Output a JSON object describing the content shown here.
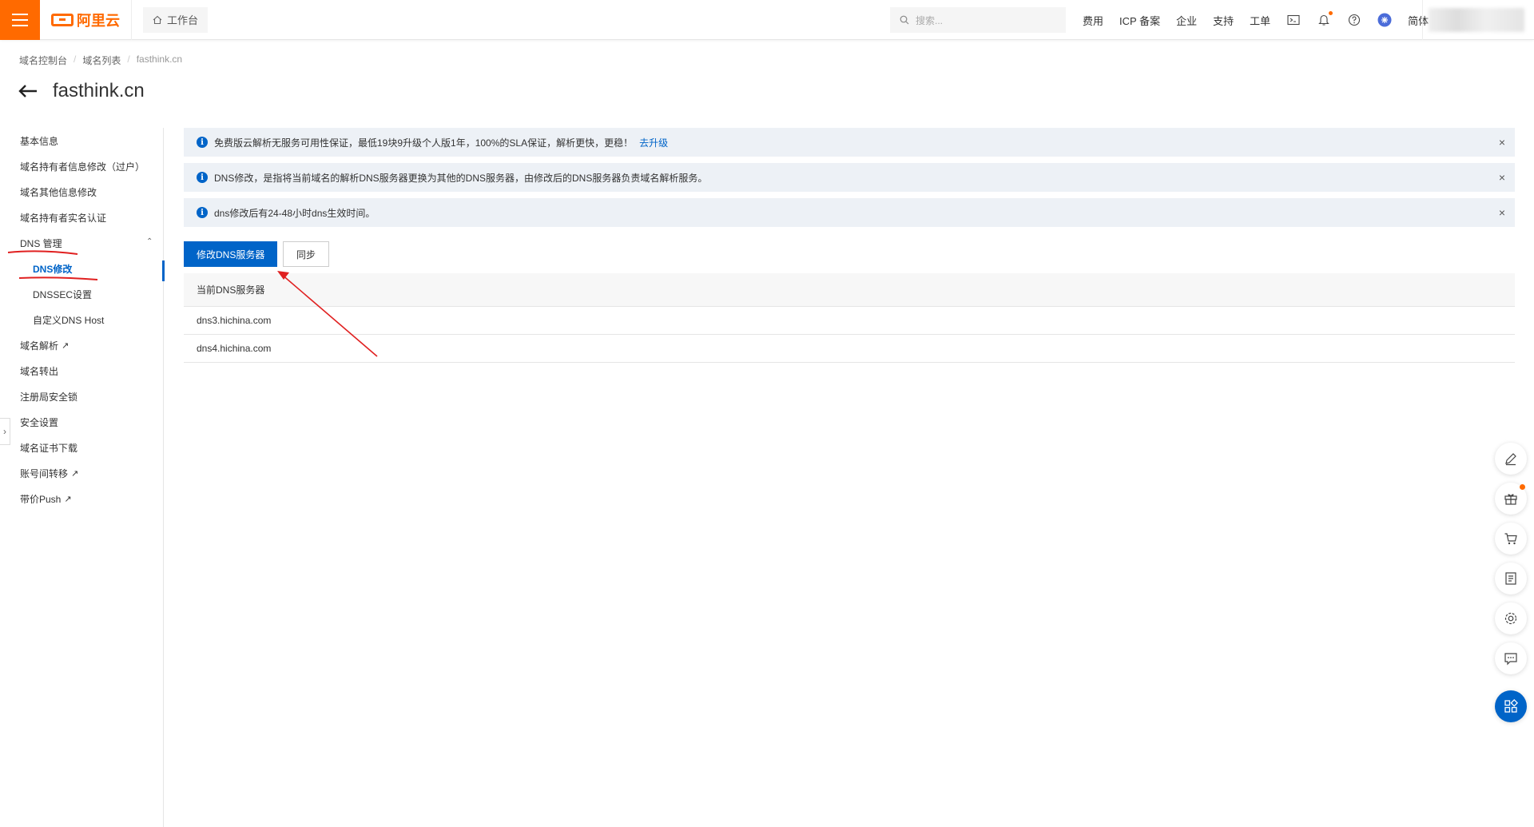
{
  "topbar": {
    "logo_text": "阿里云",
    "workbench": "工作台",
    "search_placeholder": "搜索...",
    "nav": [
      "费用",
      "ICP 备案",
      "企业",
      "支持",
      "工单"
    ],
    "lang": "简体"
  },
  "breadcrumb": [
    "域名控制台",
    "域名列表",
    "fasthink.cn"
  ],
  "page_title": "fasthink.cn",
  "sidebar": {
    "items": [
      {
        "label": "基本信息"
      },
      {
        "label": "域名持有者信息修改（过户）"
      },
      {
        "label": "域名其他信息修改"
      },
      {
        "label": "域名持有者实名认证"
      },
      {
        "label": "DNS 管理"
      },
      {
        "label": "DNS修改"
      },
      {
        "label": "DNSSEC设置"
      },
      {
        "label": "自定义DNS Host"
      },
      {
        "label": "域名解析"
      },
      {
        "label": "域名转出"
      },
      {
        "label": "注册局安全锁"
      },
      {
        "label": "安全设置"
      },
      {
        "label": "域名证书下载"
      },
      {
        "label": "账号间转移"
      },
      {
        "label": "带价Push"
      }
    ]
  },
  "notices": [
    {
      "text": "免费版云解析无服务可用性保证，最低19块9升级个人版1年，100%的SLA保证，解析更快，更稳！",
      "link": "去升级"
    },
    {
      "text": "DNS修改，是指将当前域名的解析DNS服务器更换为其他的DNS服务器，由修改后的DNS服务器负责域名解析服务。"
    },
    {
      "text": "dns修改后有24-48小时dns生效时间。"
    }
  ],
  "buttons": {
    "modify_dns": "修改DNS服务器",
    "sync": "同步"
  },
  "dns_table": {
    "header": "当前DNS服务器",
    "rows": [
      "dns3.hichina.com",
      "dns4.hichina.com"
    ]
  },
  "colors": {
    "accent": "#0064c8",
    "brand": "#ff6a00",
    "annotation": "#e02020"
  }
}
